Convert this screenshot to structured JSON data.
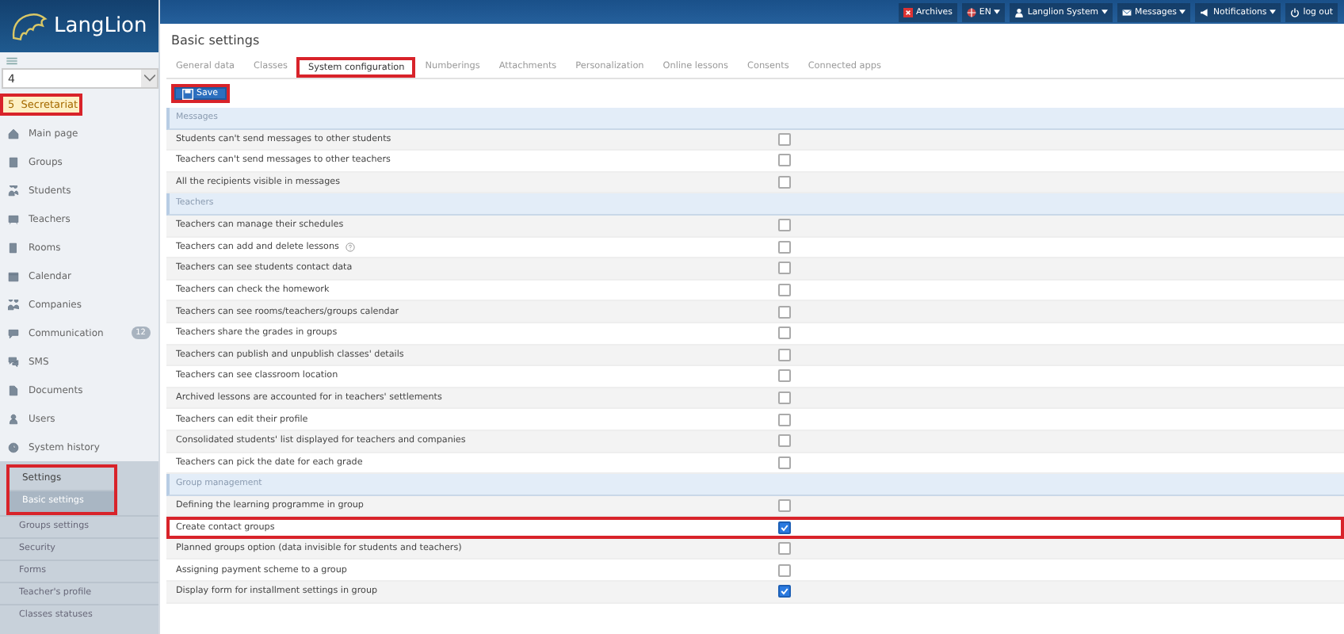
{
  "logo": {
    "text": "LangLion"
  },
  "topbar": [
    {
      "kind": "archive",
      "label": "Archives",
      "dropdown": false
    },
    {
      "kind": "flag",
      "label": "EN",
      "dropdown": true
    },
    {
      "kind": "user",
      "label": "Langlion System",
      "dropdown": true
    },
    {
      "kind": "mail",
      "label": "Messages",
      "dropdown": true
    },
    {
      "kind": "bell",
      "label": "Notifications",
      "dropdown": true
    },
    {
      "kind": "power",
      "label": "log out",
      "dropdown": false
    }
  ],
  "sidebar": {
    "select_value": "4",
    "branch": {
      "number": "5",
      "name": "Secretariat",
      "highlighted": true
    },
    "items": [
      {
        "label": "Main page"
      },
      {
        "label": "Groups"
      },
      {
        "label": "Students"
      },
      {
        "label": "Teachers"
      },
      {
        "label": "Rooms"
      },
      {
        "label": "Calendar"
      },
      {
        "label": "Companies"
      },
      {
        "label": "Communication",
        "badge": "12"
      },
      {
        "label": "SMS"
      },
      {
        "label": "Documents"
      },
      {
        "label": "Users"
      },
      {
        "label": "System history"
      }
    ],
    "settings": {
      "label": "Settings",
      "highlighted": true,
      "children": [
        {
          "label": "Basic settings",
          "selected": true
        },
        {
          "label": "Groups settings",
          "selected": false
        },
        {
          "label": "Security",
          "selected": false
        },
        {
          "label": "Forms",
          "selected": false
        },
        {
          "label": "Teacher's profile",
          "selected": false
        },
        {
          "label": "Classes statuses",
          "selected": false
        }
      ]
    }
  },
  "page_title": "Basic settings",
  "tabs": [
    {
      "label": "General data",
      "selected": false,
      "highlighted": false
    },
    {
      "label": "Classes",
      "selected": false,
      "highlighted": false
    },
    {
      "label": "System configuration",
      "selected": true,
      "highlighted": true
    },
    {
      "label": "Numberings",
      "selected": false,
      "highlighted": false
    },
    {
      "label": "Attachments",
      "selected": false,
      "highlighted": false
    },
    {
      "label": "Personalization",
      "selected": false,
      "highlighted": false
    },
    {
      "label": "Online lessons",
      "selected": false,
      "highlighted": false
    },
    {
      "label": "Consents",
      "selected": false,
      "highlighted": false
    },
    {
      "label": "Connected apps",
      "selected": false,
      "highlighted": false
    }
  ],
  "save_button": {
    "label": "Save",
    "highlighted": true
  },
  "sections": [
    {
      "title": "Messages",
      "rows": [
        {
          "label": "Students can't send messages to other students",
          "checked": false,
          "highlighted": false
        },
        {
          "label": "Teachers can't send messages to other teachers",
          "checked": false,
          "highlighted": false
        },
        {
          "label": "All the recipients visible in messages",
          "checked": false,
          "highlighted": false
        }
      ]
    },
    {
      "title": "Teachers",
      "rows": [
        {
          "label": "Teachers can manage their schedules",
          "checked": false,
          "highlighted": false
        },
        {
          "label": "Teachers can add and delete lessons",
          "checked": false,
          "highlighted": false,
          "help": true
        },
        {
          "label": "Teachers can see students contact data",
          "checked": false,
          "highlighted": false
        },
        {
          "label": "Teachers can check the homework",
          "checked": false,
          "highlighted": false
        },
        {
          "label": "Teachers can see rooms/teachers/groups calendar",
          "checked": false,
          "highlighted": false
        },
        {
          "label": "Teachers share the grades in groups",
          "checked": false,
          "highlighted": false
        },
        {
          "label": "Teachers can publish and unpublish classes' details",
          "checked": false,
          "highlighted": false
        },
        {
          "label": "Teachers can see classroom location",
          "checked": false,
          "highlighted": false
        },
        {
          "label": "Archived lessons are accounted for in teachers' settlements",
          "checked": false,
          "highlighted": false
        },
        {
          "label": "Teachers can edit their profile",
          "checked": false,
          "highlighted": false
        },
        {
          "label": "Consolidated students' list displayed for teachers and companies",
          "checked": false,
          "highlighted": false
        },
        {
          "label": "Teachers can pick the date for each grade",
          "checked": false,
          "highlighted": false
        }
      ]
    },
    {
      "title": "Group management",
      "rows": [
        {
          "label": "Defining the learning programme in group",
          "checked": false,
          "highlighted": false
        },
        {
          "label": "Create contact groups",
          "checked": true,
          "highlighted": true
        },
        {
          "label": "Planned groups option (data invisible for students and teachers)",
          "checked": false,
          "highlighted": false
        },
        {
          "label": "Assigning payment scheme to a group",
          "checked": false,
          "highlighted": false
        },
        {
          "label": "Display form for installment settings in group",
          "checked": true,
          "highlighted": false
        }
      ]
    }
  ]
}
